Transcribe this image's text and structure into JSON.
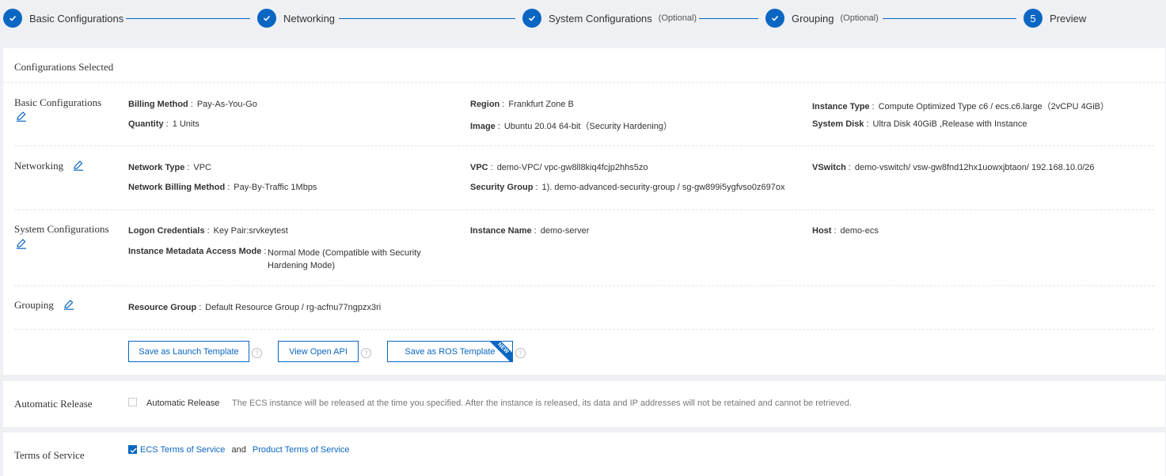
{
  "steps": [
    {
      "label": "Basic Configurations",
      "optional": "",
      "status": "done"
    },
    {
      "label": "Networking",
      "optional": "",
      "status": "done"
    },
    {
      "label": "System Configurations",
      "optional": "(Optional)",
      "status": "done"
    },
    {
      "label": "Grouping",
      "optional": "(Optional)",
      "status": "done"
    },
    {
      "label": "Preview",
      "optional": "",
      "number": "5",
      "status": "current"
    }
  ],
  "configurations": {
    "title": "Configurations Selected",
    "basic": {
      "title": "Basic Configurations",
      "fields": [
        {
          "label": "Billing Method",
          "value": "Pay-As-You-Go"
        },
        {
          "label": "Region",
          "value": "Frankfurt Zone B"
        },
        {
          "label": "Instance Type",
          "value": "Compute Optimized Type c6 / ecs.c6.large（2vCPU 4GiB）"
        },
        {
          "label": "Quantity",
          "value": "1 Units"
        },
        {
          "label": "Image",
          "value": "Ubuntu 20.04 64-bit（Security Hardening）"
        },
        {
          "label": "System Disk",
          "value": "Ultra Disk 40GiB ,Release with Instance"
        }
      ]
    },
    "networking": {
      "title": "Networking",
      "fields": [
        {
          "label": "Network Type",
          "value": "VPC"
        },
        {
          "label": "VPC",
          "value": "demo-VPC/ vpc-gw8ll8kiq4fcjp2hhs5zo"
        },
        {
          "label": "VSwitch",
          "value": "demo-vswitch/ vsw-gw8fnd12hx1uowxjbtaon/ 192.168.10.0/26"
        },
        {
          "label": "Network Billing Method",
          "value": "Pay-By-Traffic 1Mbps"
        },
        {
          "label": "Security Group",
          "value": "1). demo-advanced-security-group / sg-gw899i5ygfvso0z697ox"
        }
      ]
    },
    "system": {
      "title": "System Configurations",
      "fields": [
        {
          "label": "Logon Credentials",
          "value": "Key Pair:srvkeytest"
        },
        {
          "label": "Instance Name",
          "value": "demo-server"
        },
        {
          "label": "Host",
          "value": "demo-ecs"
        },
        {
          "label": "Instance Metadata Access Mode",
          "value_line1": "Normal Mode (Compatible with Security",
          "value_line2": "Hardening Mode)"
        }
      ]
    },
    "grouping": {
      "title": "Grouping",
      "fields": [
        {
          "label": "Resource Group",
          "value": "Default Resource Group / rg-acfnu77ngpzx3ri"
        }
      ]
    },
    "actions": {
      "save_launch_template": "Save as Launch Template",
      "view_open_api": "View Open API",
      "save_ros_template": "Save as ROS Template",
      "ros_badge": "NEW",
      "help": "?"
    }
  },
  "automatic_release": {
    "title": "Automatic Release",
    "checkbox_label": "Automatic Release",
    "checked": false,
    "description": "The ECS instance will be released at the time you specified. After the instance is released, its data and IP addresses will not be retained and cannot be retrieved."
  },
  "terms": {
    "title": "Terms of Service",
    "checked": true,
    "link1": "ECS Terms of Service",
    "conjunction": "and",
    "link2": "Product Terms of Service"
  },
  "colors": {
    "accent": "#0a66c2",
    "background": "#eef0f4"
  }
}
